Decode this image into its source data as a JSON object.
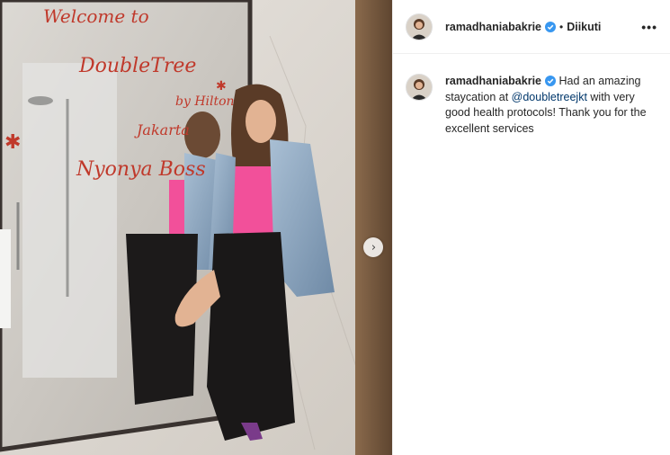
{
  "post": {
    "username": "ramadhaniabakrie",
    "follow_status": "Diikuti",
    "separator": "•",
    "more_label": "•••",
    "caption_before": "Had an amazing staycation at ",
    "caption_mention": "@doubletreejkt",
    "caption_after": " with very good health protocols! Thank you for the excellent services"
  },
  "media": {
    "mirror_lines": [
      "Welcome to",
      "DoubleTree",
      "by Hilton",
      "Jakarta",
      "Nyonya Boss"
    ],
    "next_glyph": "›"
  },
  "colors": {
    "verified": "#3897f0",
    "mirror_text": "#c0392b",
    "top": "#f2509a"
  }
}
